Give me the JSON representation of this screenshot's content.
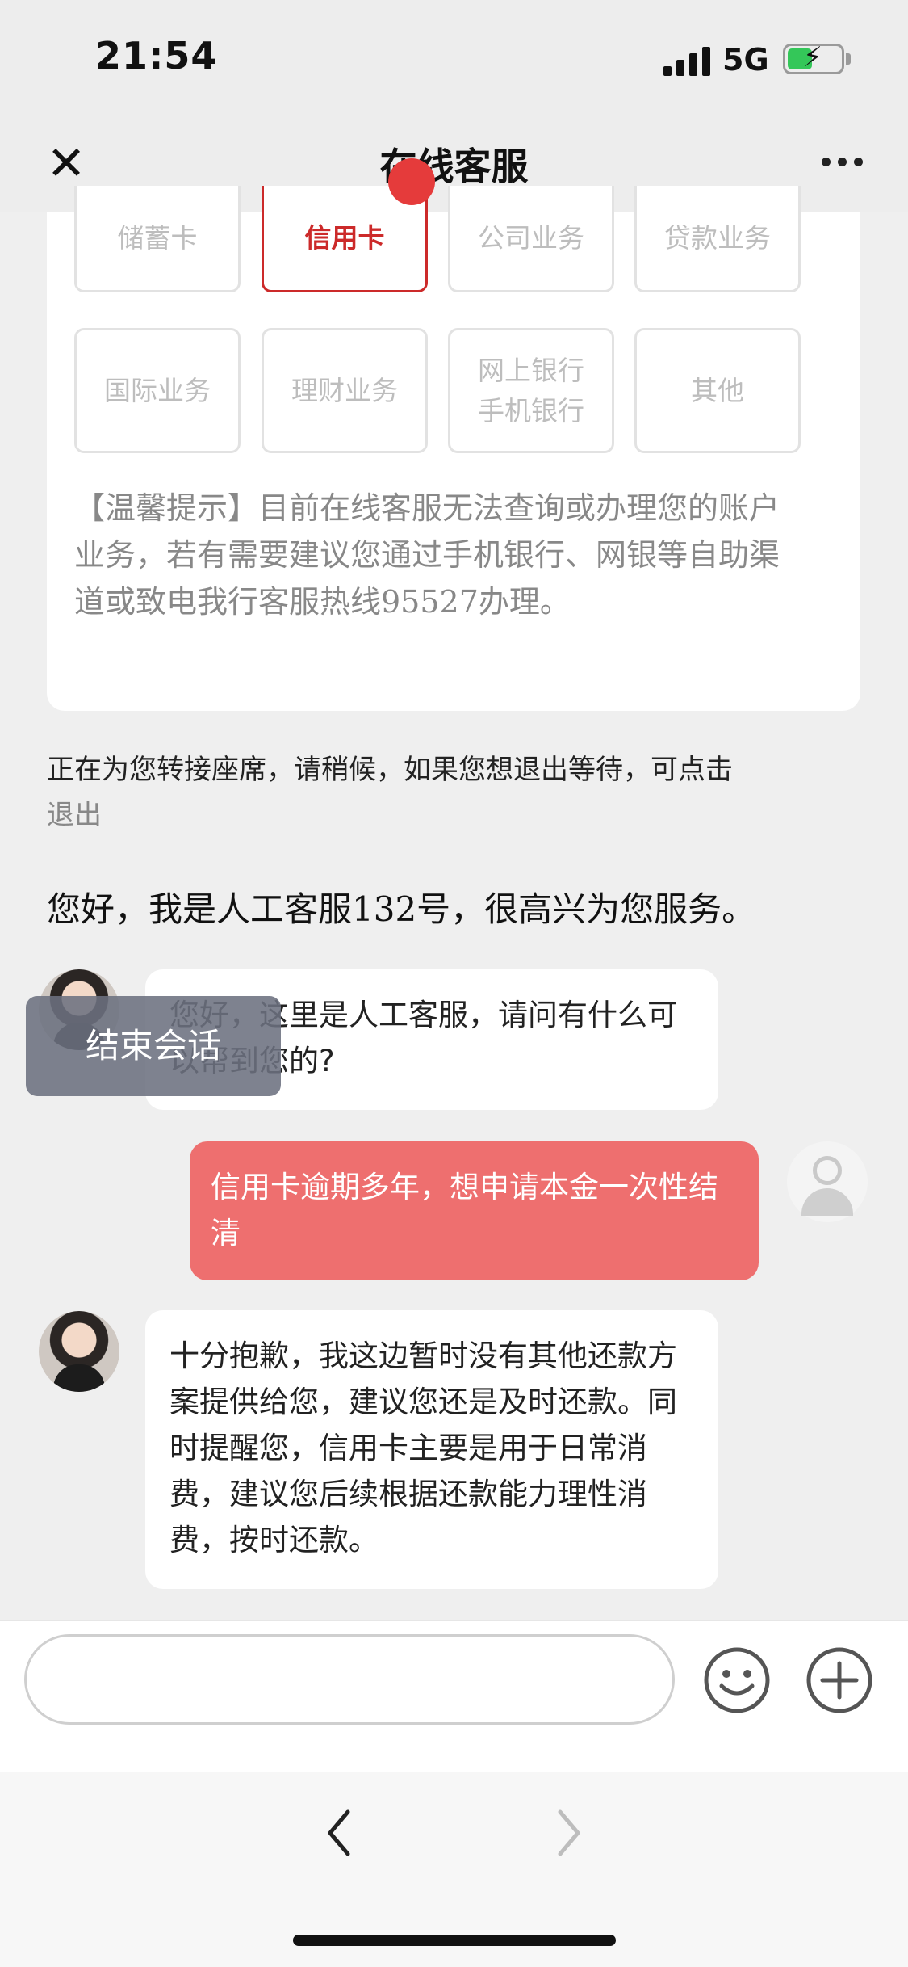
{
  "status_bar": {
    "time": "21:54",
    "network": "5G"
  },
  "nav": {
    "title": "在线客服"
  },
  "categories": {
    "row1": [
      "储蓄卡",
      "信用卡",
      "公司业务",
      "贷款业务"
    ],
    "row2": [
      "国际业务",
      "理财业务",
      "网上银行",
      "手机银行",
      "其他"
    ],
    "active": "信用卡"
  },
  "tip": {
    "text": "【温馨提示】目前在线客服无法查询或办理您的账户业务，若有需要建议您通过手机银行、网银等自助渠道或致电我行客服热线95527办理。"
  },
  "conversation": {
    "transfer_notice": "正在为您转接座席，请稍候，如果您想退出等待，可点击",
    "exit_link": "退出",
    "welcome": "您好，我是人工客服132号，很高兴为您服务。",
    "agent_msg_1": "您好，这里是人工客服，请问有什么可以帮到您的?",
    "user_msg_1": "信用卡逾期多年，想申请本金一次性结清",
    "agent_msg_2": "十分抱歉，我这边暂时没有其他还款方案提供给您，建议您还是及时还款。同时提醒您，信用卡主要是用于日常消费，建议您后续根据还款能力理性消费，按时还款。",
    "end_session_popup": "结束会话"
  },
  "input": {
    "value": "",
    "placeholder": ""
  },
  "colors": {
    "accent_red": "#cc2a2a",
    "user_bubble": "#ee6f6f",
    "battery_green": "#34c759"
  },
  "icons": {
    "close": "close-icon",
    "more": "more-icon",
    "emoji": "emoji-icon",
    "plus": "plus-icon",
    "back": "back-arrow-icon",
    "forward": "forward-arrow-icon"
  }
}
